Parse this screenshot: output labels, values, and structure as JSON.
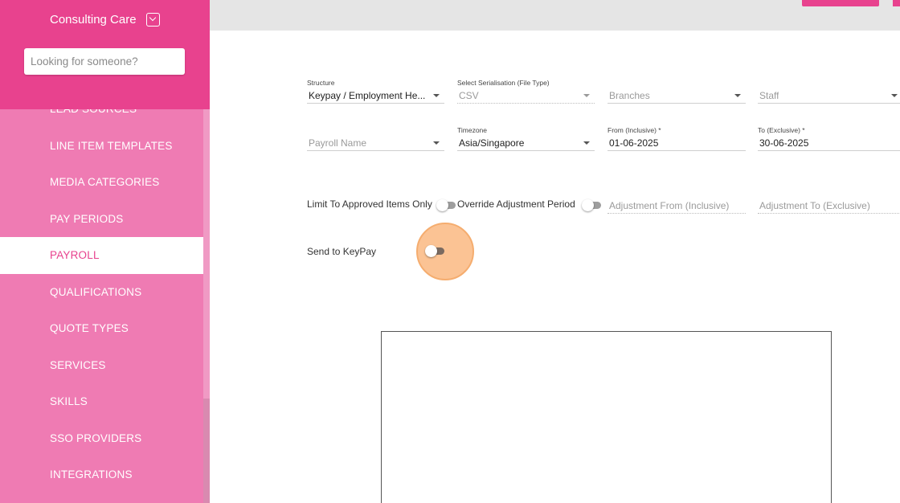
{
  "app": {
    "brand": "Consulting Care",
    "search_placeholder": "Looking for someone?"
  },
  "sidebar": {
    "items": [
      {
        "label": "LEAD SOURCES",
        "active": false
      },
      {
        "label": "LINE ITEM TEMPLATES",
        "active": false
      },
      {
        "label": "MEDIA CATEGORIES",
        "active": false
      },
      {
        "label": "PAY PERIODS",
        "active": false
      },
      {
        "label": "PAYROLL",
        "active": true
      },
      {
        "label": "QUALIFICATIONS",
        "active": false
      },
      {
        "label": "QUOTE TYPES",
        "active": false
      },
      {
        "label": "SERVICES",
        "active": false
      },
      {
        "label": "SKILLS",
        "active": false
      },
      {
        "label": "SSO PROVIDERS",
        "active": false
      },
      {
        "label": "INTEGRATIONS",
        "active": false
      }
    ]
  },
  "form": {
    "structure": {
      "label": "Structure",
      "value": "Keypay / Employment He..."
    },
    "serialisation": {
      "label": "Select Serialisation (File Type)",
      "value": "CSV"
    },
    "branches": {
      "placeholder": "Branches"
    },
    "staff": {
      "placeholder": "Staff"
    },
    "payroll_name": {
      "placeholder": "Payroll Name"
    },
    "timezone": {
      "label": "Timezone",
      "value": "Asia/Singapore"
    },
    "from": {
      "label": "From (Inclusive) *",
      "value": "01-06-2025"
    },
    "to": {
      "label": "To (Exclusive) *",
      "value": "30-06-2025"
    },
    "limit_approved": {
      "label": "Limit To Approved Items Only",
      "on": false
    },
    "override_adjustment": {
      "label": "Override Adjustment Period",
      "on": false
    },
    "adjustment_from": {
      "placeholder": "Adjustment From (Inclusive)"
    },
    "adjustment_to": {
      "placeholder": "Adjustment To (Exclusive)"
    },
    "send_to_keypay": {
      "label": "Send to KeyPay",
      "on": false
    }
  },
  "colors": {
    "brand": "#e8428e",
    "sidebar": "#ef7bb3",
    "ripple": "#fbc08f"
  }
}
